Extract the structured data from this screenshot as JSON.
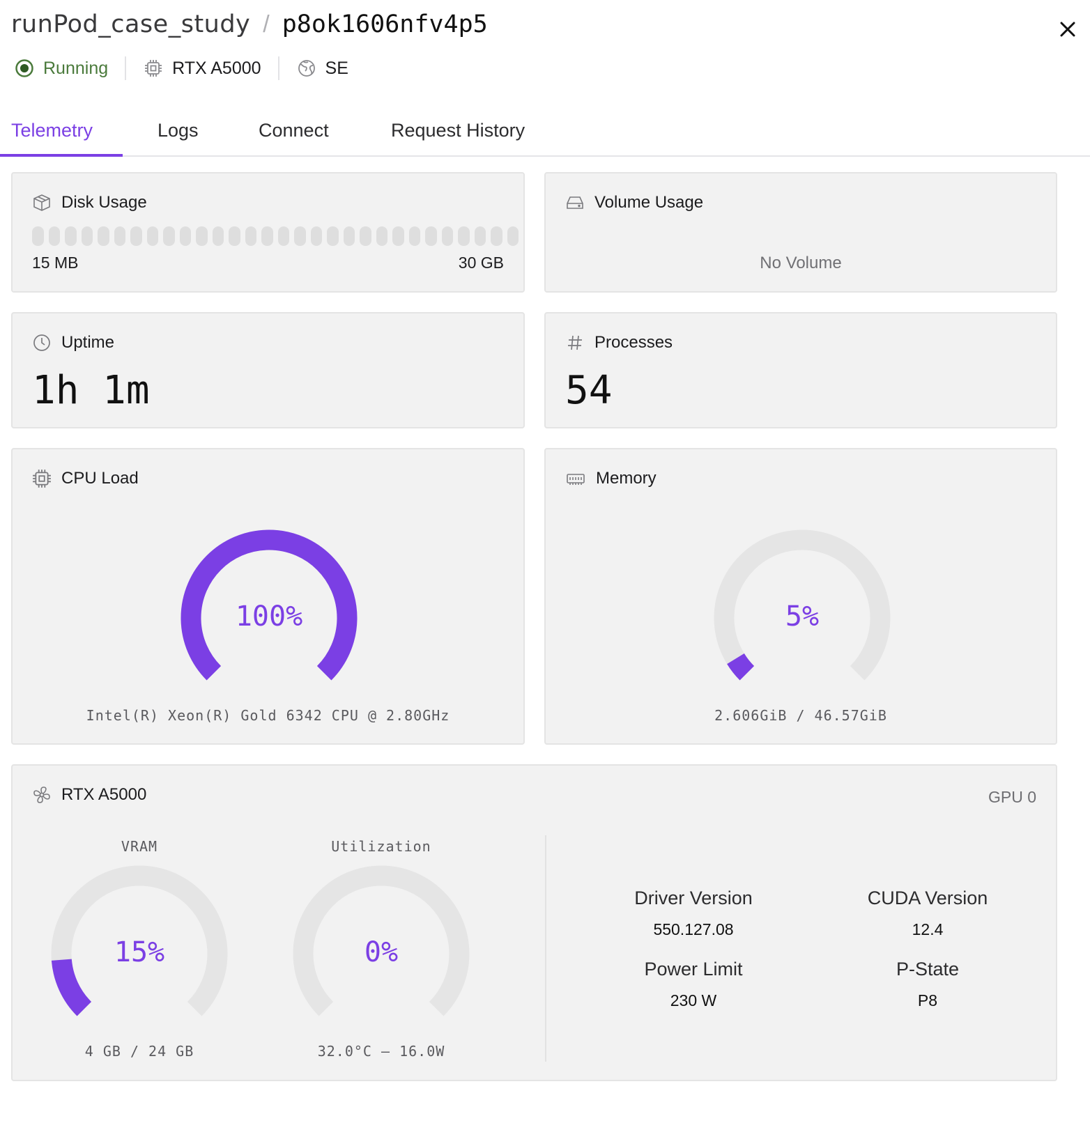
{
  "header": {
    "project": "runPod_case_study",
    "separator": "/",
    "pod_id": "p8ok1606nfv4p5"
  },
  "status": {
    "state": "Running",
    "gpu": "RTX A5000",
    "region": "SE",
    "colors": {
      "running": "#4a7a3b"
    }
  },
  "tabs": [
    {
      "label": "Telemetry",
      "active": true
    },
    {
      "label": "Logs",
      "active": false
    },
    {
      "label": "Connect",
      "active": false
    },
    {
      "label": "Request History",
      "active": false
    }
  ],
  "theme": {
    "accent": "#7b3fe4",
    "track": "#e5e5e5"
  },
  "disk": {
    "title": "Disk Usage",
    "used": "15 MB",
    "total": "30 GB",
    "fill_fraction": 0.0005
  },
  "volume": {
    "title": "Volume Usage",
    "empty_text": "No Volume"
  },
  "uptime": {
    "title": "Uptime",
    "value": "1h 1m"
  },
  "processes": {
    "title": "Processes",
    "value": "54"
  },
  "cpu": {
    "title": "CPU Load",
    "percent": 100,
    "percent_label": "100%",
    "model": "Intel(R) Xeon(R) Gold 6342 CPU @ 2.80GHz"
  },
  "memory": {
    "title": "Memory",
    "percent": 5,
    "percent_label": "5%",
    "detail": "2.606GiB / 46.57GiB"
  },
  "gpu_card": {
    "title": "RTX A5000",
    "gpu_index": "GPU 0",
    "vram": {
      "label": "VRAM",
      "percent": 15,
      "percent_label": "15%",
      "detail": "4 GB / 24 GB"
    },
    "utilization": {
      "label": "Utilization",
      "percent": 0,
      "percent_label": "0%",
      "detail": "32.0°C – 16.0W"
    },
    "specs": {
      "driver_label": "Driver Version",
      "driver_value": "550.127.08",
      "cuda_label": "CUDA Version",
      "cuda_value": "12.4",
      "power_label": "Power Limit",
      "power_value": "230 W",
      "pstate_label": "P-State",
      "pstate_value": "P8"
    }
  }
}
